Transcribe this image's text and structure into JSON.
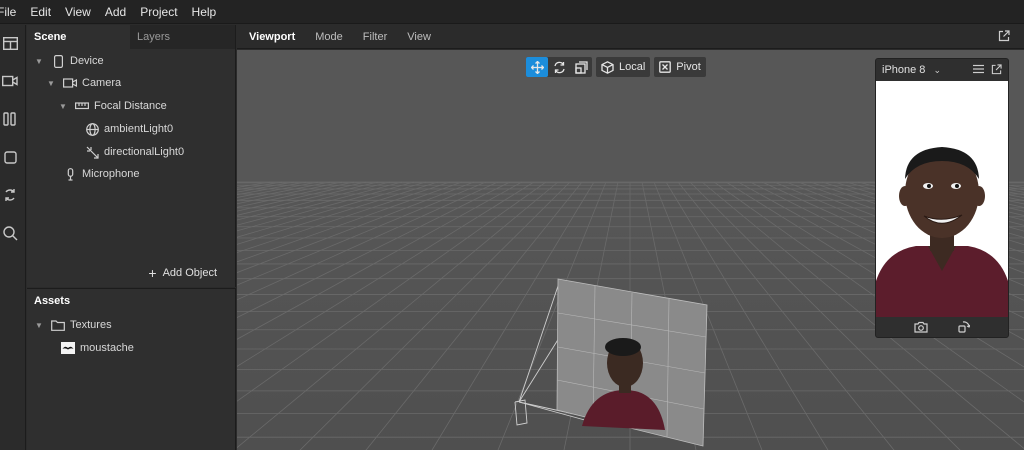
{
  "menu": [
    "File",
    "Edit",
    "View",
    "Add",
    "Project",
    "Help"
  ],
  "scene_panel": {
    "tabs": [
      "Scene",
      "Layers"
    ],
    "tree": {
      "device": "Device",
      "camera": "Camera",
      "focal_distance": "Focal Distance",
      "ambient_light": "ambientLight0",
      "directional_light": "directionalLight0",
      "microphone": "Microphone"
    },
    "add_object": "Add Object"
  },
  "assets_panel": {
    "title": "Assets",
    "folder": "Textures",
    "item": "moustache"
  },
  "viewport_header": {
    "tabs": [
      "Viewport",
      "Mode",
      "Filter",
      "View"
    ]
  },
  "gizmo": {
    "local_label": "Local",
    "pivot_label": "Pivot"
  },
  "preview": {
    "device": "iPhone 8"
  },
  "colors": {
    "accent": "#1c8ddb",
    "viewport_bg": "#575757",
    "panel_bg": "#2f2f2f"
  }
}
